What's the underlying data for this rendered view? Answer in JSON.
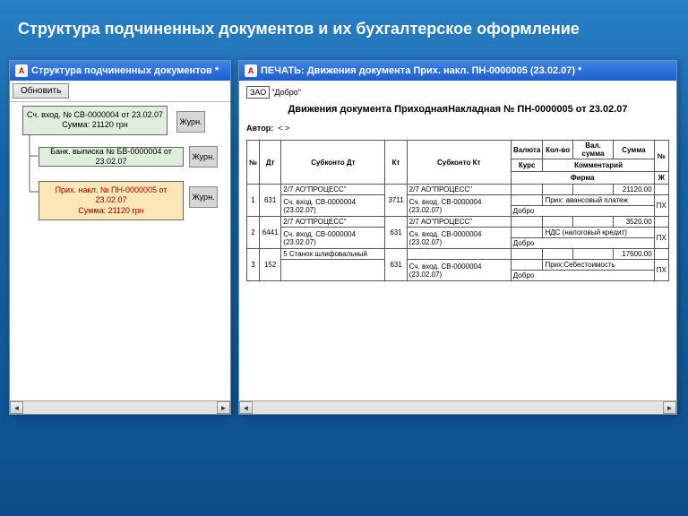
{
  "slide_title": "Структура подчиненных документов и их бухгалтерское оформление",
  "left_window": {
    "title": "Структура подчиненных документов  *",
    "refresh_btn": "Обновить",
    "nodes": [
      {
        "line1": "Сч. вход. № СВ-0000004 от 23.02.07",
        "line2": "Сумма: 21120 грн"
      },
      {
        "line1": "Банк. выписка № БВ-0000004 от 23.02.07",
        "line2": ""
      },
      {
        "line1": "Прих. накл. № ПН-0000005 от 23.02.07",
        "line2": "Сумма: 21120 грн"
      }
    ],
    "journ_label": "Журн."
  },
  "right_window": {
    "title": "ПЕЧАТЬ: Движения документа Прих. накл. ПН-0000005 (23.02.07)  *",
    "org_prefix": "ЗАО",
    "org_name": "\"Добро\"",
    "heading": "Движения документа ПриходнаяНакладная № ПН-0000005 от 23.02.07",
    "author_label": "Автор:",
    "author_val": "< >",
    "headers": {
      "no": "№",
      "dt": "Дт",
      "sub_dt": "Субконто Дт",
      "kt": "Кт",
      "sub_kt": "Субконто Кт",
      "valuta": "Валюта",
      "kolvo": "Кол-во",
      "valsum": "Вал. сумма",
      "summa": "Сумма",
      "no2": "№",
      "kurs": "Курс",
      "comment": "Комментарий",
      "zh": "Ж",
      "firma": "Фирма"
    },
    "rows": [
      {
        "n": "1",
        "dt": "631",
        "sub_dt_l1": "2/7 АО\"ПРОЦЕСС\"",
        "sub_dt_l2": "Сч. вход. СВ-0000004 (23.02.07)",
        "kt": "3711",
        "sub_kt_l1": "2/7 АО\"ПРОЦЕСС\"",
        "sub_kt_l2": "Сч. вход. СВ-0000004 (23.02.07)",
        "amount": "21120.00",
        "comment": "Прих: авансовый платеж",
        "zh": "ПХ",
        "firma": "Добро"
      },
      {
        "n": "2",
        "dt": "6441",
        "sub_dt_l1": "2/7 АО\"ПРОЦЕСС\"",
        "sub_dt_l2": "Сч. вход. СВ-0000004 (23.02.07)",
        "kt": "631",
        "sub_kt_l1": "2/7 АО\"ПРОЦЕСС\"",
        "sub_kt_l2": "Сч. вход. СВ-0000004 (23.02.07)",
        "amount": "3520.00",
        "comment": "НДС (налоговый кредит)",
        "zh": "ПХ",
        "firma": "Добро"
      },
      {
        "n": "3",
        "dt": "152",
        "sub_dt_l1": "5 Станок шлифовальный",
        "sub_dt_l2": "",
        "kt": "631",
        "sub_kt_l1": "",
        "sub_kt_l2": "Сч. вход. СВ-0000004 (23.02.07)",
        "amount": "17600.00",
        "comment": "Прих:Себестоимость",
        "zh": "ПХ",
        "firma": "Добро"
      }
    ]
  }
}
